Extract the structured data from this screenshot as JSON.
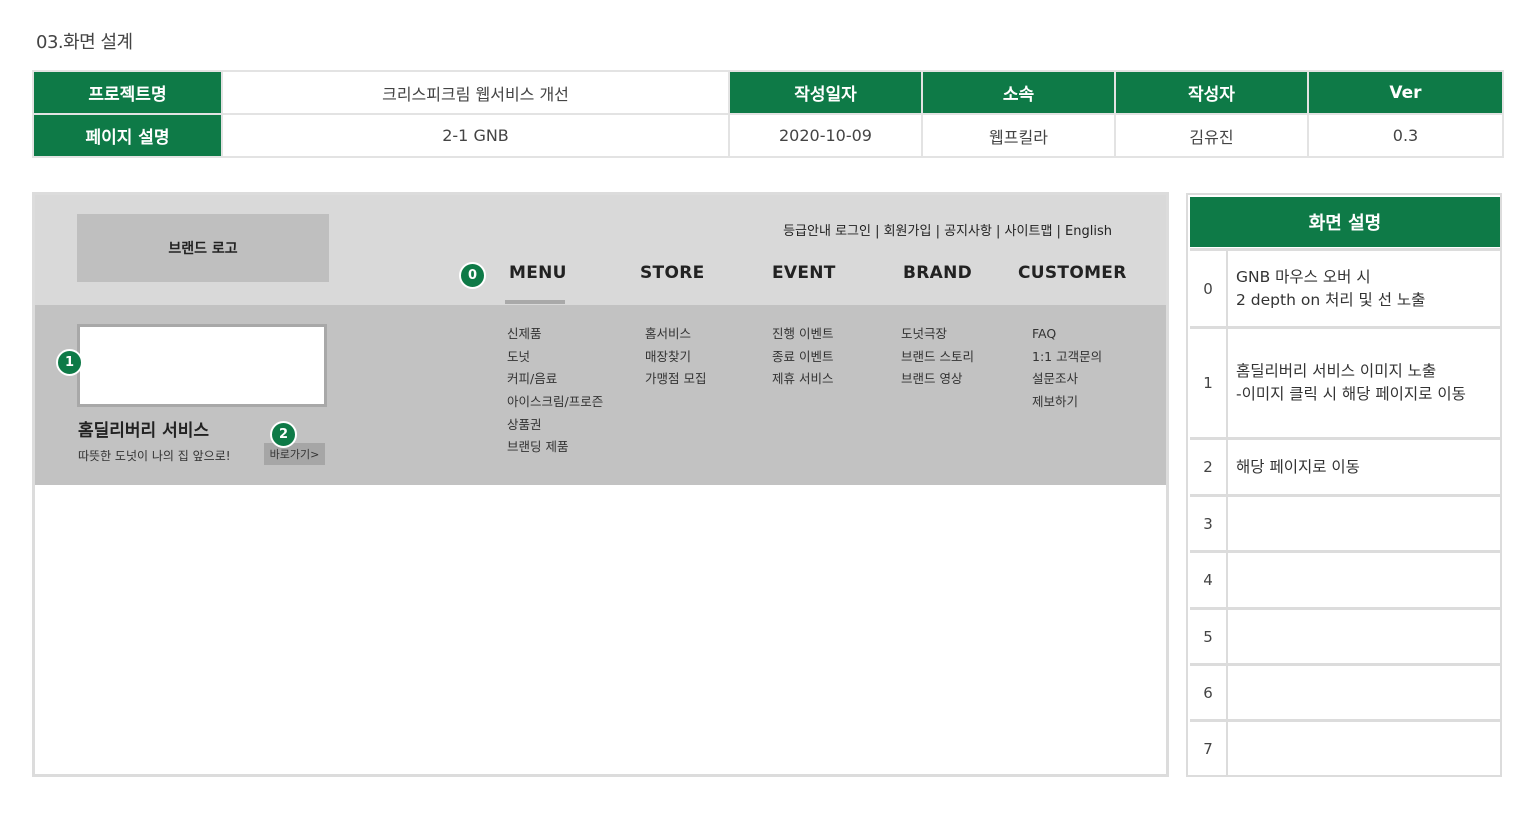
{
  "section_title": "03.화면 설계",
  "info": {
    "labels": {
      "project_name": "프로젝트명",
      "page_desc": "페이지 설명",
      "date": "작성일자",
      "org": "소속",
      "author": "작성자",
      "ver": "Ver"
    },
    "values": {
      "project_name": "크리스피크림 웹서비스 개선",
      "page_desc": "2-1 GNB",
      "date": "2020-10-09",
      "org": "웹프킬라",
      "author": "김유진",
      "ver": "0.3"
    }
  },
  "gnb": {
    "logo": "브랜드 로고",
    "util_links": "등급안내  로그인 | 회원가입 | 공지사항 | 사이트맵 | English",
    "nav": [
      "MENU",
      "STORE",
      "EVENT",
      "BRAND",
      "CUSTOMER"
    ],
    "sub": [
      [
        "신제품",
        "도넛",
        "커피/음료",
        "아이스크림/프로즌",
        "상품권",
        "브랜딩 제품"
      ],
      [
        "홈서비스",
        "매장찾기",
        "가맹점 모집"
      ],
      [
        "진행 이벤트",
        "종료 이벤트",
        "제휴 서비스"
      ],
      [
        "도넛극장",
        "브랜드 스토리",
        "브랜드 영상"
      ],
      [
        "FAQ",
        "1:1 고객문의",
        "설문조사",
        "제보하기"
      ]
    ],
    "promo": {
      "title": "홈딜리버리 서비스",
      "subtitle": "따뜻한 도넛이 나의 집 앞으로!",
      "button": "바로가기>"
    },
    "badges": [
      "0",
      "1",
      "2"
    ]
  },
  "desc_panel": {
    "title": "화면 설명",
    "rows": [
      {
        "num": "0",
        "text": "GNB 마우스 오버 시\n2 depth on 처리 및 선 노출"
      },
      {
        "num": "1",
        "text": "홈딜리버리 서비스 이미지 노출\n-이미지 클릭 시 해당 페이지로 이동"
      },
      {
        "num": "2",
        "text": "해당 페이지로 이동"
      },
      {
        "num": "3",
        "text": ""
      },
      {
        "num": "4",
        "text": ""
      },
      {
        "num": "5",
        "text": ""
      },
      {
        "num": "6",
        "text": ""
      },
      {
        "num": "7",
        "text": ""
      }
    ]
  },
  "colors": {
    "accent": "#0e7a47",
    "gnb_top": "#d9d9d9",
    "gnb_drop": "#c2c2c2"
  }
}
